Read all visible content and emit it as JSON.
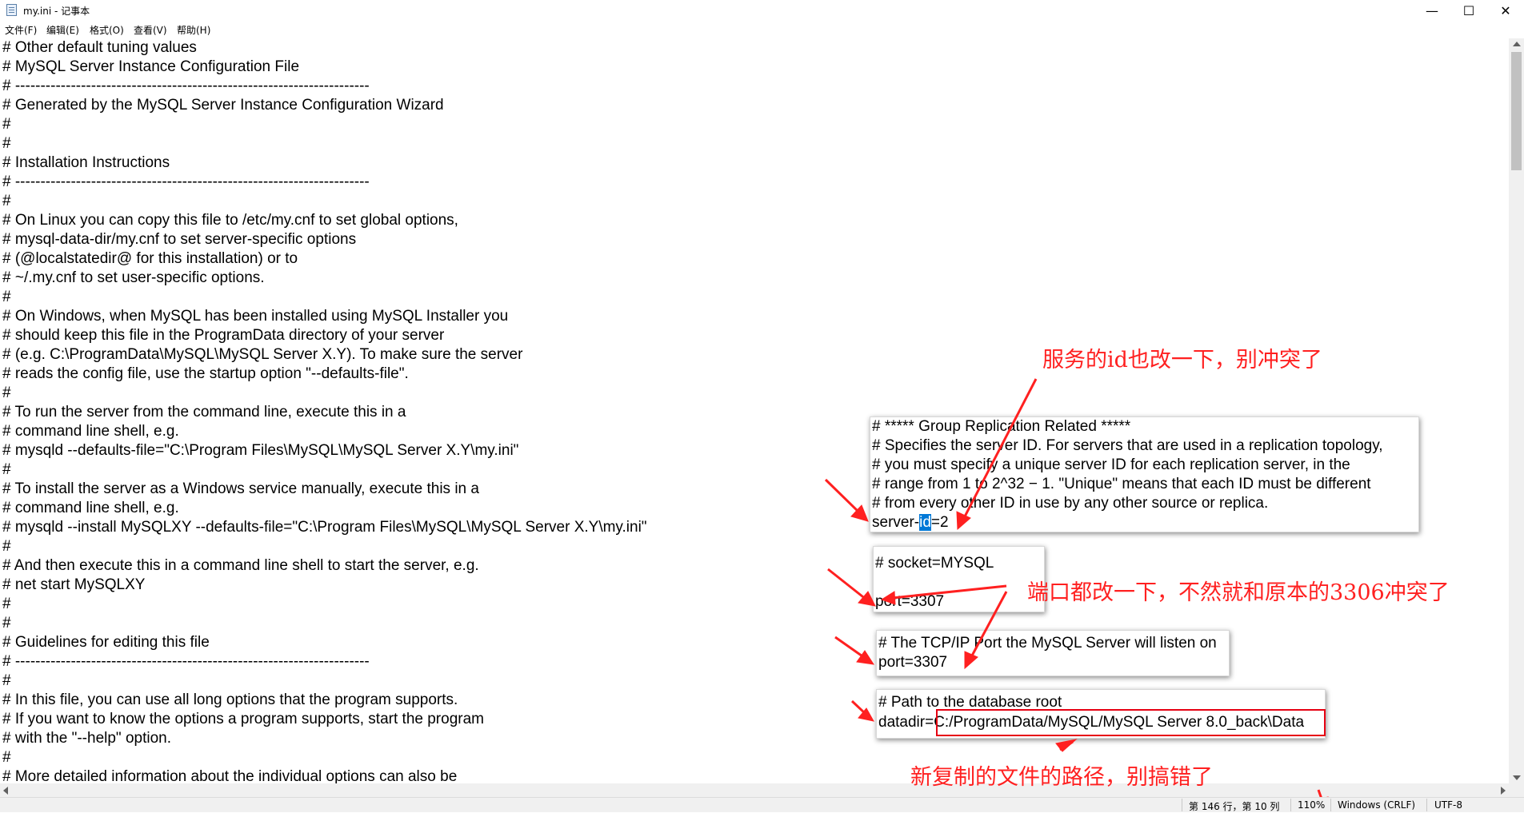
{
  "window": {
    "title": "my.ini - 记事本",
    "minimize_label": "—",
    "maximize_label": "☐",
    "close_label": "✕"
  },
  "menu": {
    "items": [
      "文件(F)",
      "编辑(E)",
      "格式(O)",
      "查看(V)",
      "帮助(H)"
    ]
  },
  "editor": {
    "lines": [
      "# Other default tuning values",
      "# MySQL Server Instance Configuration File",
      "# ----------------------------------------------------------------------",
      "# Generated by the MySQL Server Instance Configuration Wizard",
      "#",
      "#",
      "# Installation Instructions",
      "# ----------------------------------------------------------------------",
      "#",
      "# On Linux you can copy this file to /etc/my.cnf to set global options,",
      "# mysql-data-dir/my.cnf to set server-specific options",
      "# (@localstatedir@ for this installation) or to",
      "# ~/.my.cnf to set user-specific options.",
      "#",
      "# On Windows, when MySQL has been installed using MySQL Installer you",
      "# should keep this file in the ProgramData directory of your server",
      "# (e.g. C:\\ProgramData\\MySQL\\MySQL Server X.Y). To make sure the server",
      "# reads the config file, use the startup option \"--defaults-file\".",
      "#",
      "# To run the server from the command line, execute this in a",
      "# command line shell, e.g.",
      "# mysqld --defaults-file=\"C:\\Program Files\\MySQL\\MySQL Server X.Y\\my.ini\"",
      "#",
      "# To install the server as a Windows service manually, execute this in a",
      "# command line shell, e.g.",
      "# mysqld --install MySQLXY --defaults-file=\"C:\\Program Files\\MySQL\\MySQL Server X.Y\\my.ini\"",
      "#",
      "# And then execute this in a command line shell to start the server, e.g.",
      "# net start MySQLXY",
      "#",
      "#",
      "# Guidelines for editing this file",
      "# ----------------------------------------------------------------------",
      "#",
      "# In this file, you can use all long options that the program supports.",
      "# If you want to know the options a program supports, start the program",
      "# with the \"--help\" option.",
      "#",
      "# More detailed information about the individual options can also be"
    ]
  },
  "overlays": {
    "server_id": {
      "lines": [
        "# ***** Group Replication Related *****",
        "# Specifies the server ID. For servers that are used in a replication topology,",
        "# you must specify a unique server ID for each replication server, in the",
        "# range from 1 to 2^32 − 1. \"Unique\" means that each ID must be different",
        "# from every other ID in use by any other source or replica."
      ],
      "key_prefix": "server-",
      "key_selected": "id",
      "key_value": "=2"
    },
    "socket": {
      "line1": "# socket=MYSQL",
      "line2": "port=3307"
    },
    "tcp_port": {
      "line1": "# The TCP/IP Port the MySQL Server will listen on",
      "line2": "port=3307"
    },
    "datadir": {
      "line1": "# Path to the database root",
      "key": "datadir=",
      "value": "C:/ProgramData/MySQL/MySQL Server 8.0_back\\Data"
    }
  },
  "annotations": {
    "server_id_note": "服务的id也改一下，别冲突了",
    "port_note": "端口都改一下，不然就和原本的3306冲突了",
    "path_note": "新复制的文件的路径，别搞错了",
    "color": "#ff2020"
  },
  "statusbar": {
    "position": "第 146 行，第 10 列",
    "zoom": "110%",
    "line_ending": "Windows (CRLF)",
    "encoding": "UTF-8"
  }
}
